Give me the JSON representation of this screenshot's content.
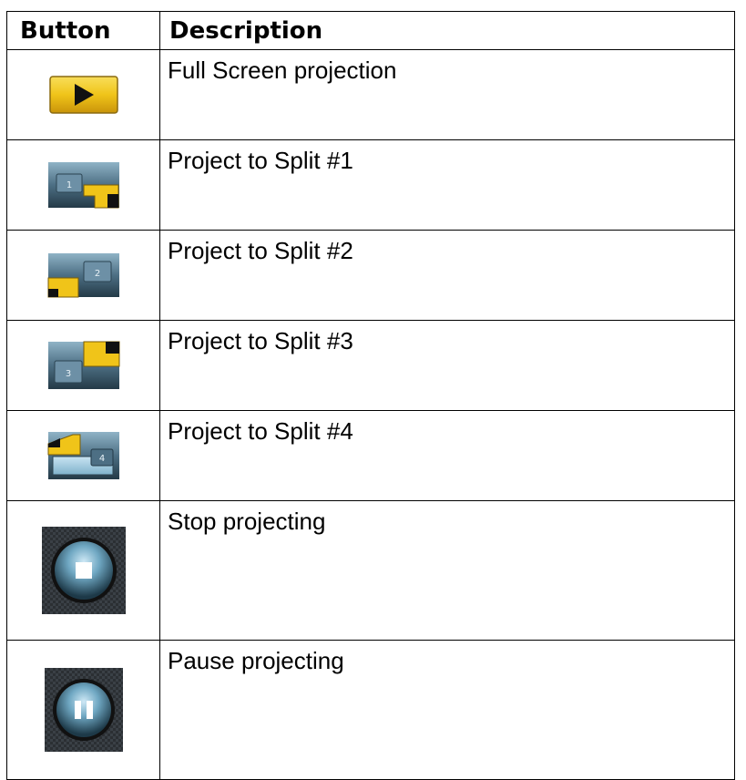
{
  "table": {
    "headers": {
      "button": "Button",
      "description": "Description"
    },
    "rows": [
      {
        "icon": "play-icon",
        "description": "Full Screen projection"
      },
      {
        "icon": "split-1-icon",
        "description": "Project to Split #1"
      },
      {
        "icon": "split-2-icon",
        "description": "Project to Split #2"
      },
      {
        "icon": "split-3-icon",
        "description": "Project to Split #3"
      },
      {
        "icon": "split-4-icon",
        "description": "Project to Split #4"
      },
      {
        "icon": "stop-icon",
        "description": "Stop projecting"
      },
      {
        "icon": "pause-icon",
        "description": "Pause projecting"
      }
    ],
    "icon_labels": {
      "split1": "1",
      "split2": "2",
      "split3": "3",
      "split4": "4"
    }
  },
  "colors": {
    "border": "#000000",
    "yellow": "#f0c419",
    "slate": "#4d6f84",
    "dark": "#1b2a33"
  }
}
